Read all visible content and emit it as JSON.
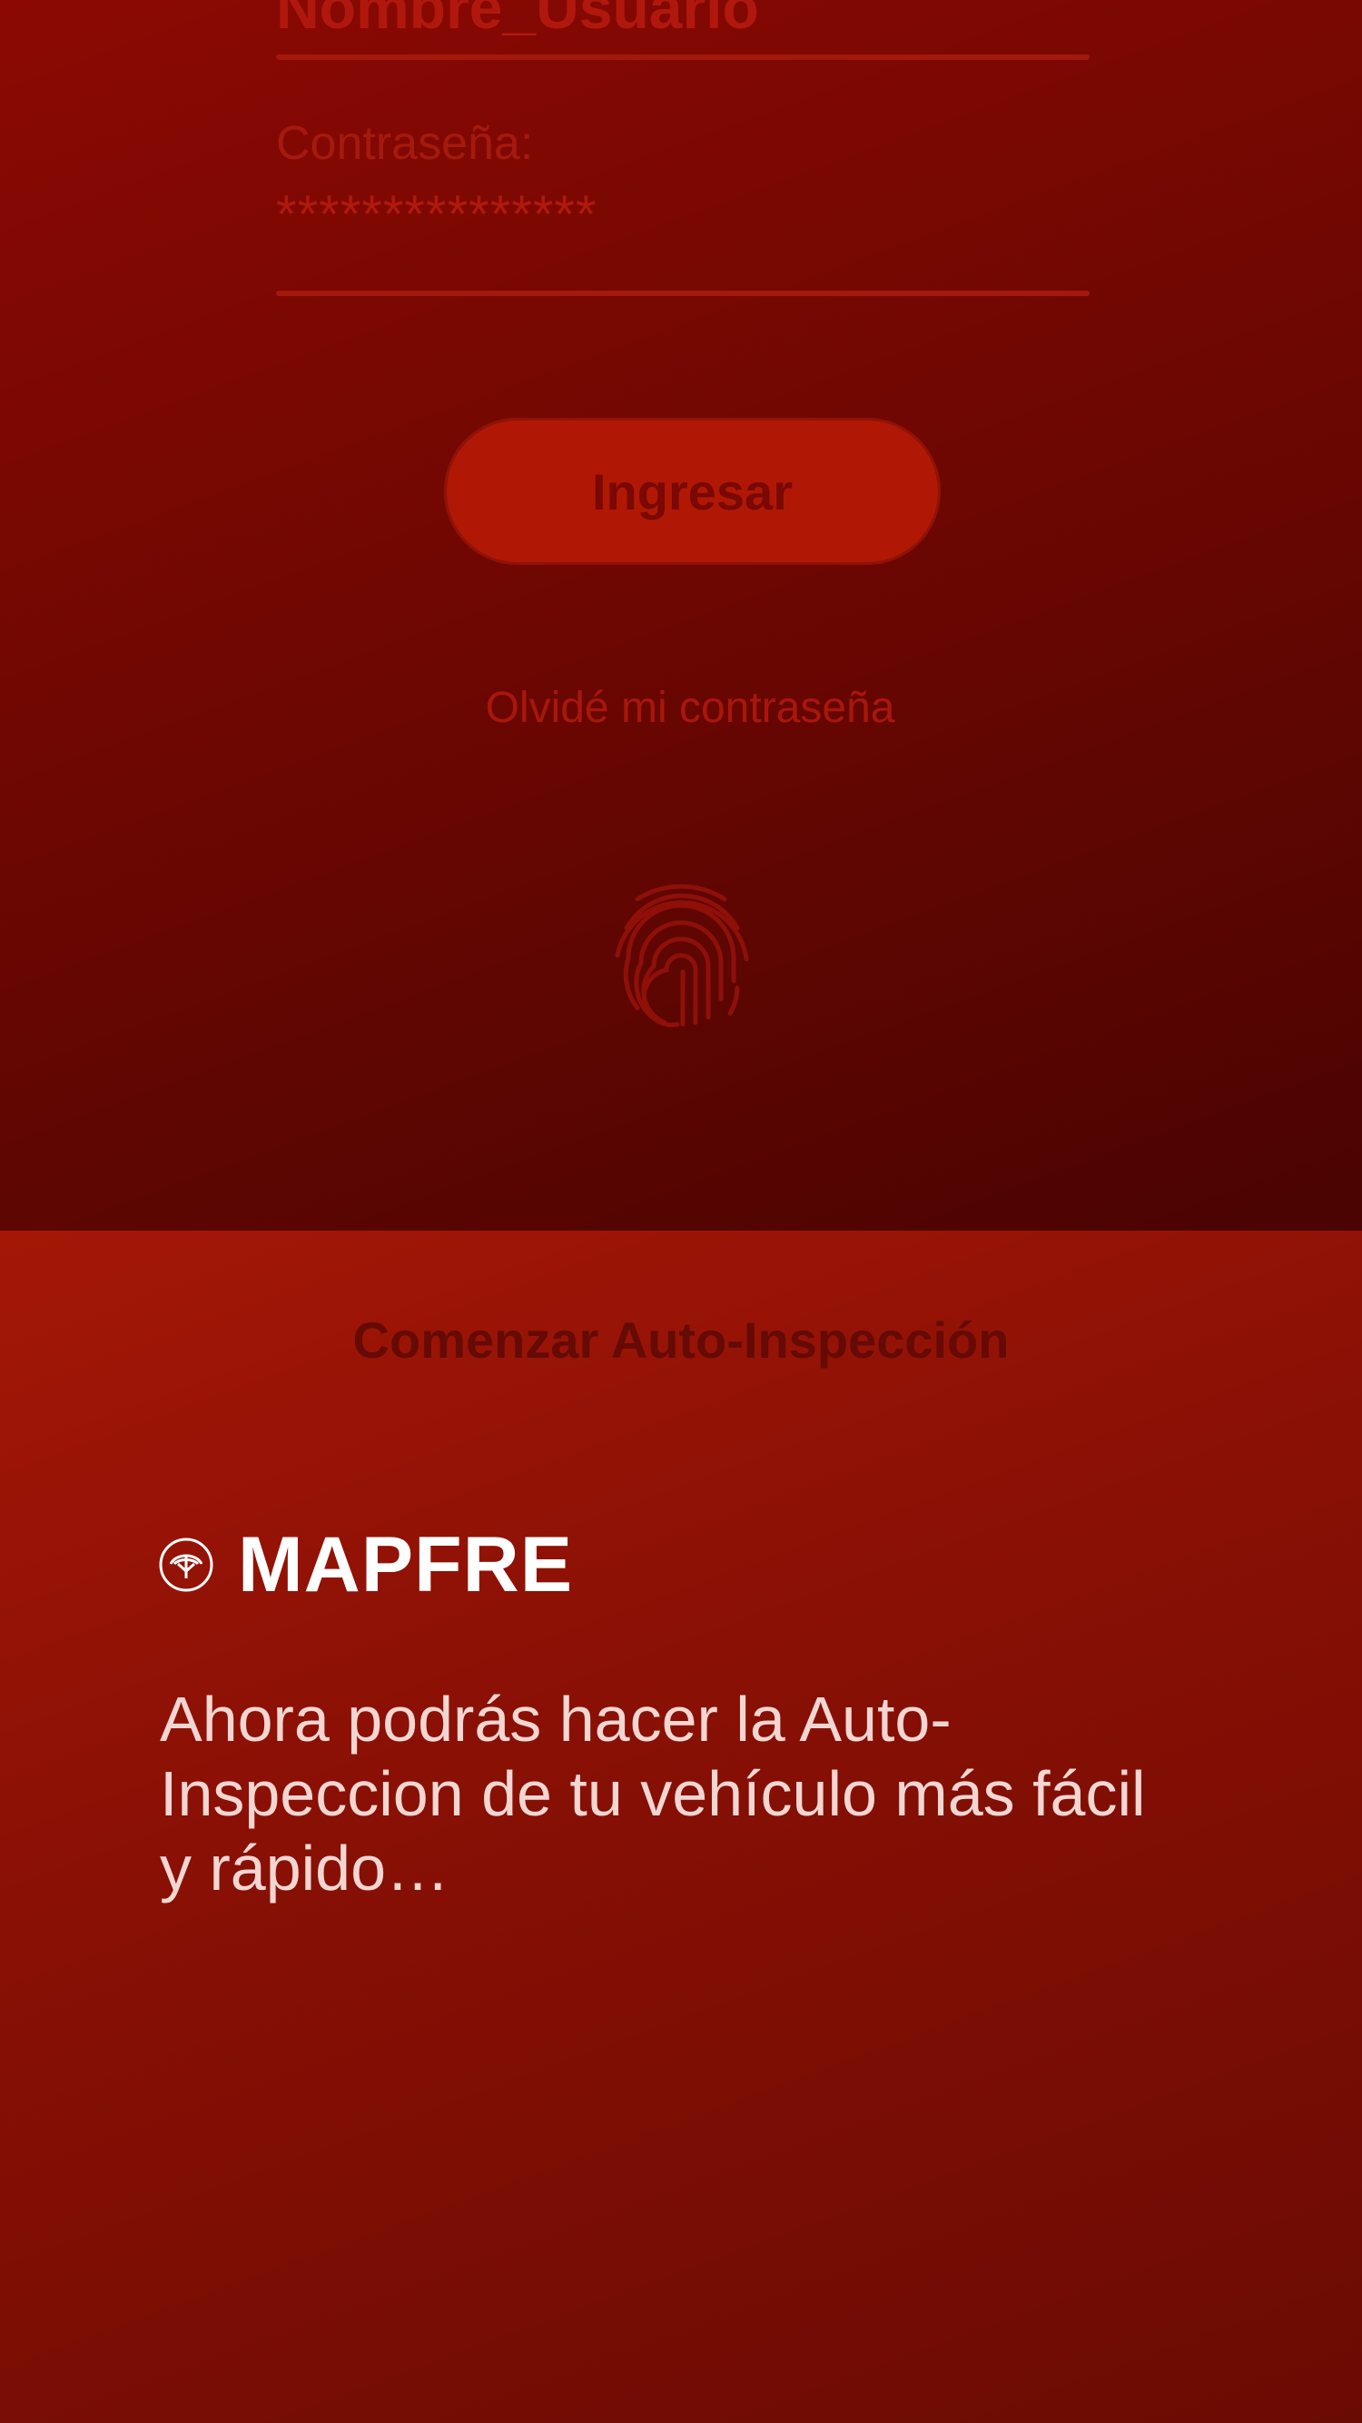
{
  "login": {
    "username_value": "Nombre_Usuario",
    "password_label": "Contraseña:",
    "password_value": "***************",
    "login_button": "Ingresar",
    "forgot_password": "Olvidé mi contraseña",
    "fingerprint_icon": "fingerprint-icon"
  },
  "inspection": {
    "start_link": "Comenzar Auto-Inspección",
    "brand": "MAPFRE",
    "brand_icon": "mapfre-tree-icon",
    "tagline": "Ahora podrás hacer la Auto-Inspeccion de tu vehículo más fácil y rápido…"
  },
  "colors": {
    "top_background": "#6f0702",
    "bottom_background": "#8a1005",
    "button_fill": "#b01805",
    "brand_text": "#ffffff"
  }
}
